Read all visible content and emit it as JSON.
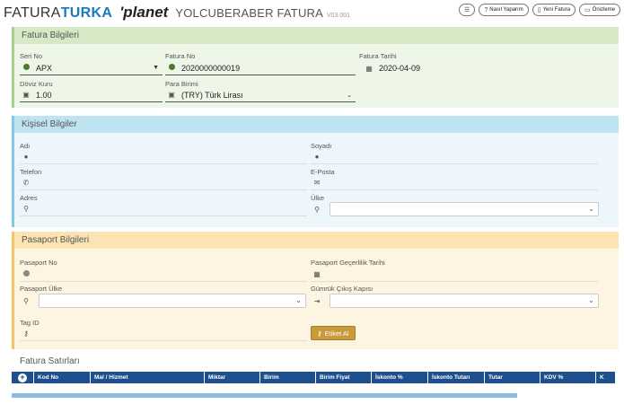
{
  "header": {
    "logo_fatura": "FATURA",
    "logo_turka": "TURKA",
    "logo_planet": "'planet",
    "subtitle": "YOLCUBERABER FATURA",
    "version": "V03.001",
    "buttons": {
      "menu_icon": "list-icon",
      "nasil_label": "Nasıl Yaparım",
      "yeni_label": "Yeni Fatura",
      "onizleme_label": "Önizleme"
    }
  },
  "fatura_bilgileri": {
    "title": "Fatura Bilgileri",
    "seri_no_label": "Seri No",
    "seri_no_value": "APX",
    "fatura_no_label": "Fatura No",
    "fatura_no_value": "2020000000019",
    "fatura_tarihi_label": "Fatura Tarihi",
    "fatura_tarihi_value": "2020-04-09",
    "doviz_kuru_label": "Döviz Kuru",
    "doviz_kuru_value": "1.00",
    "para_birimi_label": "Para Birimi",
    "para_birimi_value": "(TRY) Türk Lirası"
  },
  "kisisel_bilgiler": {
    "title": "Kişisel Bilgiler",
    "adi_label": "Adı",
    "soyadi_label": "Soyadı",
    "telefon_label": "Telefon",
    "eposta_label": "E-Posta",
    "adres_label": "Adres",
    "ulke_label": "Ülke"
  },
  "pasaport_bilgileri": {
    "title": "Pasaport Bilgileri",
    "pasaport_no_label": "Pasaport No",
    "gecerlilik_label": "Pasaport Geçerlilik Tarihi",
    "pasaport_ulke_label": "Pasaport Ülke",
    "gumruk_label": "Gümrük Çıkış Kapısı",
    "tag_id_label": "Tag ID",
    "etiket_button": "Etiket Al"
  },
  "fatura_satirlari": {
    "title": "Fatura Satırları",
    "columns": [
      "Kod No",
      "Mal / Hizmet",
      "Miktar",
      "Birim",
      "Birim Fiyat",
      "İskonto %",
      "İskonto Tutarı",
      "Tutar",
      "KDV %",
      "K"
    ]
  },
  "colors": {
    "green_accent": "#a8d08d",
    "blue_accent": "#85c7e5",
    "orange_accent": "#f0c36d",
    "grid_header": "#1e4f8f",
    "brand_blue": "#1a7bbd"
  }
}
